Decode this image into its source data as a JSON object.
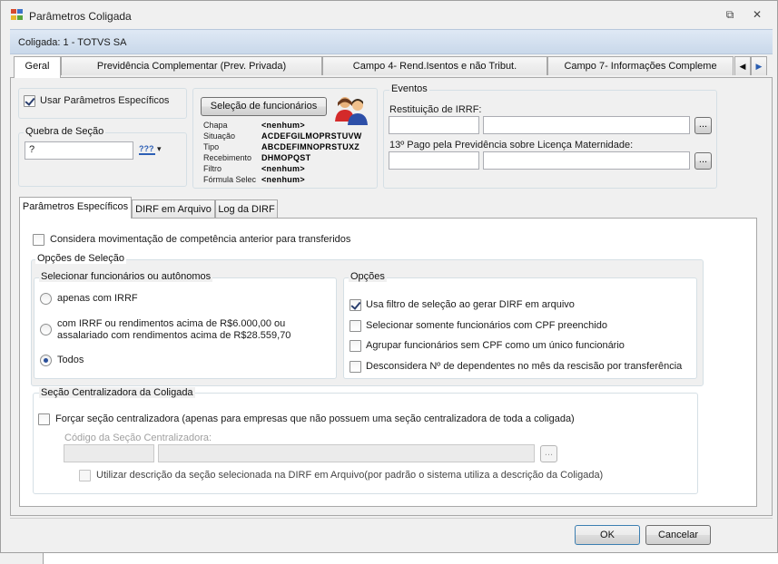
{
  "window": {
    "title": "Parâmetros Coligada",
    "pin_glyph": "⧉",
    "close_glyph": "✕"
  },
  "coligada_label": "Coligada: 1 - TOTVS SA",
  "main_tabs": [
    {
      "label": "Geral"
    },
    {
      "label": "Previdência Complementar (Prev. Privada)"
    },
    {
      "label": "Campo 4- Rend.Isentos e não Tribut."
    },
    {
      "label": "Campo 7- Informações Compleme"
    }
  ],
  "tab_scroll": {
    "left": "◀",
    "right": "▶"
  },
  "geral": {
    "usar_parametros": {
      "label": "Usar Parâmetros Específicos",
      "checked": true
    },
    "quebra_secao": {
      "title": "Quebra de Seção",
      "value": "?",
      "picker_glyph": "???",
      "dropdown_glyph": "▾"
    },
    "selecao": {
      "button_label": "Seleção de funcionários",
      "rows": [
        {
          "label": "Chapa",
          "value": "<nenhum>"
        },
        {
          "label": "Situação",
          "value": "ACDEFGILMOPRSTUVW"
        },
        {
          "label": "Tipo",
          "value": "ABCDEFIMNOPRSTUXZ"
        },
        {
          "label": "Recebimento",
          "value": "DHMOPQST"
        },
        {
          "label": "Filtro",
          "value": "<nenhum>"
        },
        {
          "label": "Fórmula Selec",
          "value": "<nenhum>"
        }
      ]
    },
    "eventos": {
      "title": "Eventos",
      "restituicao_label": "Restituição de IRRF:",
      "decimo_label": "13º Pago pela Previdência sobre Licença Maternidade:",
      "ellipsis": "..."
    }
  },
  "sub_tabs": [
    {
      "label": "Parâmetros Específicos"
    },
    {
      "label": "DIRF em Arquivo"
    },
    {
      "label": "Log da DIRF"
    }
  ],
  "especificos": {
    "considera": {
      "label": "Considera movimentação de competência anterior para transferidos",
      "checked": false
    },
    "opcoes_selecao_title": "Opções de Seleção",
    "selecionar": {
      "title": "Selecionar funcionários ou autônomos",
      "options": [
        {
          "label": "apenas com IRRF",
          "checked": false
        },
        {
          "label_line1": "com IRRF ou rendimentos acima de R$6.000,00 ou",
          "label_line2": "assalariado com rendimentos acima de R$28.559,70",
          "checked": false
        },
        {
          "label": "Todos",
          "checked": true
        }
      ]
    },
    "opcoes": {
      "title": "Opções",
      "items": [
        {
          "label": "Usa filtro de seleção ao gerar DIRF em arquivo",
          "checked": true
        },
        {
          "label": "Selecionar somente funcionários com CPF preenchido",
          "checked": false
        },
        {
          "label": "Agrupar funcionários sem CPF como um único funcionário",
          "checked": false
        },
        {
          "label": "Desconsidera Nº de dependentes no mês da rescisão por transferência",
          "checked": false
        }
      ]
    },
    "secao_centralizadora": {
      "title": "Seção Centralizadora da Coligada",
      "forcar": {
        "label": "Forçar seção centralizadora  (apenas para empresas que não possuem uma seção centralizadora de toda a coligada)",
        "checked": false
      },
      "codigo_label": "Código da Seção Centralizadora:",
      "ellipsis": "...",
      "utilizar": {
        "label": "Utilizar descrição da seção selecionada na DIRF em Arquivo(por padrão o sistema utiliza a descrição da Coligada)",
        "checked": false
      }
    }
  },
  "footer": {
    "ok": "OK",
    "cancel": "Cancelar"
  },
  "colors": {
    "title_bar_bg": "#f0f0f0",
    "coligada_bar": "#d4e1f0",
    "check_mark": "#2a3e6e",
    "radio_dot": "#2a4f9a"
  }
}
